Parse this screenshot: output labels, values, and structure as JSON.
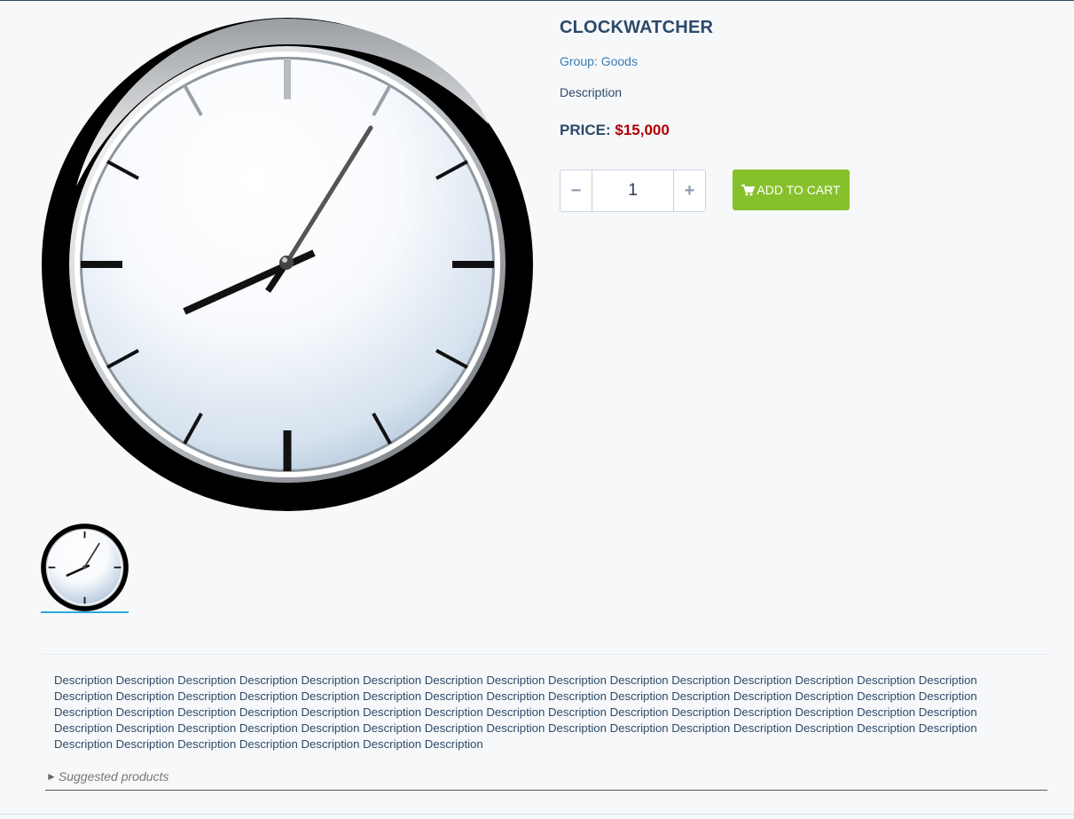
{
  "product": {
    "title": "CLOCKWATCHER",
    "group": "Group: Goods",
    "short_description": "Description",
    "price_label": "PRICE:",
    "price_value": "$15,000",
    "image_icon": "wall-clock-image"
  },
  "quantity": {
    "minus_label": "−",
    "plus_label": "+",
    "value": "1"
  },
  "cart": {
    "button_label": "ADD TO CART",
    "icon": "shopping-cart-icon"
  },
  "long_description": "Description Description Description Description Description Description Description Description Description Description Description Description Description Description Description Description Description Description Description Description Description Description Description Description Description Description Description Description Description Description Description Description Description Description Description Description Description Description Description Description Description Description Description Description Description Description Description Description Description Description Description Description Description Description Description Description Description Description Description Description Description Description Description Description Description Description Description",
  "suggested": {
    "arrow": "►",
    "label": "Suggested products"
  },
  "colors": {
    "accent": "#86c12c",
    "title": "#2c4a6a",
    "price": "#b00000",
    "link": "#3b7bb0",
    "thumb_active": "#2ba6de"
  }
}
